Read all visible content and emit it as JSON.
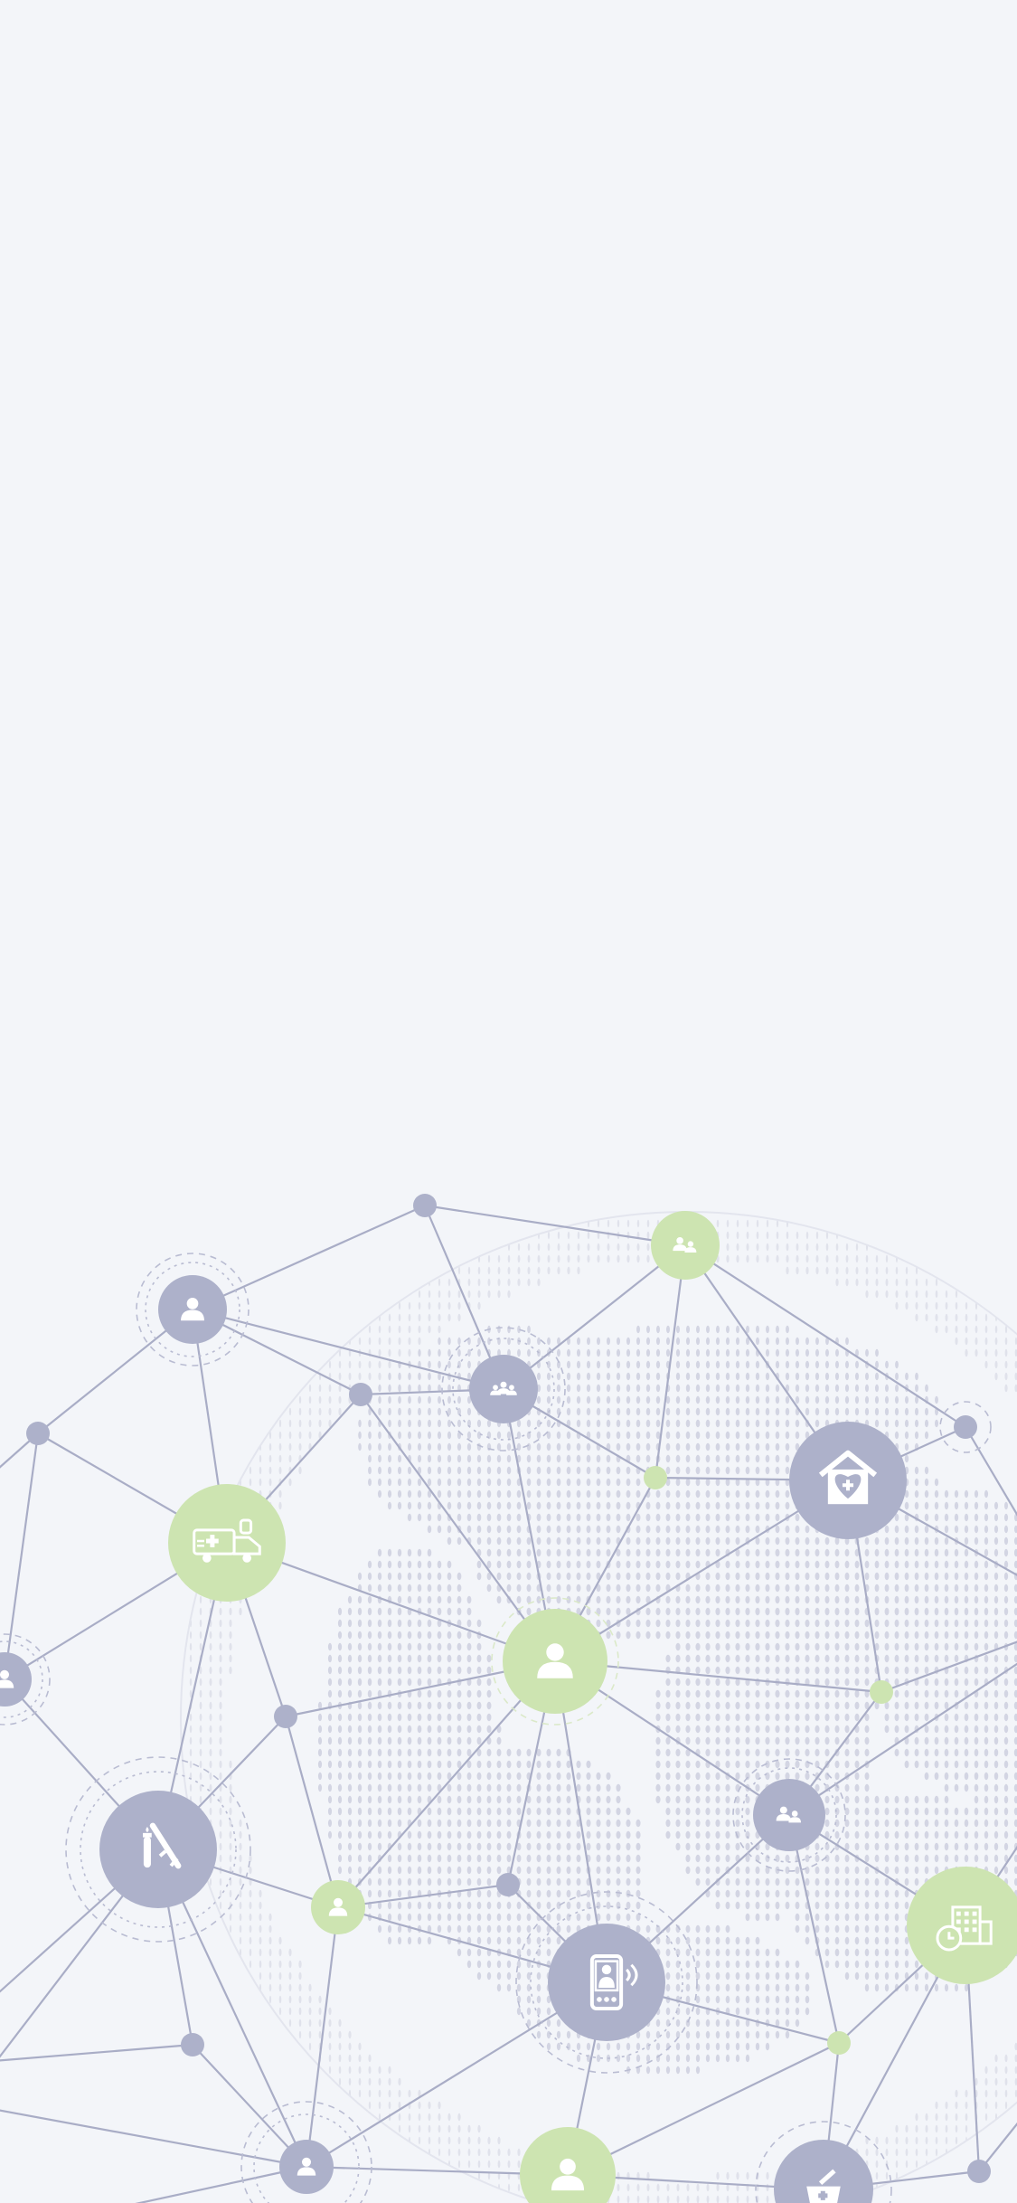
{
  "colors": {
    "background": "#f3f5f9",
    "network_line": "#a9adc6",
    "node_gray": "#adb1ca",
    "node_green": "#cde4b1",
    "map_dot": "#cfd2e0",
    "icon_white": "#ffffff"
  },
  "network": {
    "nodes": [
      {
        "id": "n-top",
        "kind": "dot",
        "tone": "gray",
        "icon": "none"
      },
      {
        "id": "n-family-green",
        "kind": "icon",
        "tone": "green",
        "icon": "family-icon"
      },
      {
        "id": "n-user-topleft",
        "kind": "icon",
        "tone": "gray",
        "icon": "user-icon"
      },
      {
        "id": "n-group-center",
        "kind": "icon",
        "tone": "gray",
        "icon": "group-icon"
      },
      {
        "id": "n-dot-a",
        "kind": "dot",
        "tone": "gray",
        "icon": "none"
      },
      {
        "id": "n-dot-left",
        "kind": "dot",
        "tone": "gray",
        "icon": "none"
      },
      {
        "id": "n-ambulance",
        "kind": "icon",
        "tone": "green",
        "icon": "ambulance-icon"
      },
      {
        "id": "n-hospital-home",
        "kind": "icon",
        "tone": "gray",
        "icon": "hospital-heart-icon"
      },
      {
        "id": "n-dot-right",
        "kind": "dot",
        "tone": "gray",
        "icon": "none"
      },
      {
        "id": "n-dot-green-mid",
        "kind": "dot",
        "tone": "green",
        "icon": "none"
      },
      {
        "id": "n-user-center",
        "kind": "icon",
        "tone": "green",
        "icon": "user-icon"
      },
      {
        "id": "n-dot-b",
        "kind": "dot",
        "tone": "gray",
        "icon": "none"
      },
      {
        "id": "n-user-edge-left",
        "kind": "icon",
        "tone": "gray",
        "icon": "user-icon"
      },
      {
        "id": "n-dot-green-right",
        "kind": "dot",
        "tone": "green",
        "icon": "none"
      },
      {
        "id": "n-syringe",
        "kind": "icon",
        "tone": "gray",
        "icon": "syringe-vial-icon"
      },
      {
        "id": "n-patients",
        "kind": "icon",
        "tone": "gray",
        "icon": "patients-icon"
      },
      {
        "id": "n-user-small-green",
        "kind": "icon",
        "tone": "green",
        "icon": "user-icon"
      },
      {
        "id": "n-dot-c",
        "kind": "dot",
        "tone": "gray",
        "icon": "none"
      },
      {
        "id": "n-clinic",
        "kind": "icon",
        "tone": "green",
        "icon": "clinic-clock-icon"
      },
      {
        "id": "n-telehealth",
        "kind": "icon",
        "tone": "gray",
        "icon": "telemedicine-phone-icon"
      },
      {
        "id": "n-dot-d",
        "kind": "dot",
        "tone": "gray",
        "icon": "none"
      },
      {
        "id": "n-dot-green-low",
        "kind": "dot",
        "tone": "green",
        "icon": "none"
      },
      {
        "id": "n-user-bottom",
        "kind": "icon",
        "tone": "gray",
        "icon": "user-icon"
      },
      {
        "id": "n-user-bottom-green",
        "kind": "icon",
        "tone": "green",
        "icon": "user-icon"
      },
      {
        "id": "n-medkit",
        "kind": "icon",
        "tone": "gray",
        "icon": "medicine-basket-icon"
      },
      {
        "id": "n-dot-br",
        "kind": "dot",
        "tone": "gray",
        "icon": "none"
      }
    ]
  }
}
